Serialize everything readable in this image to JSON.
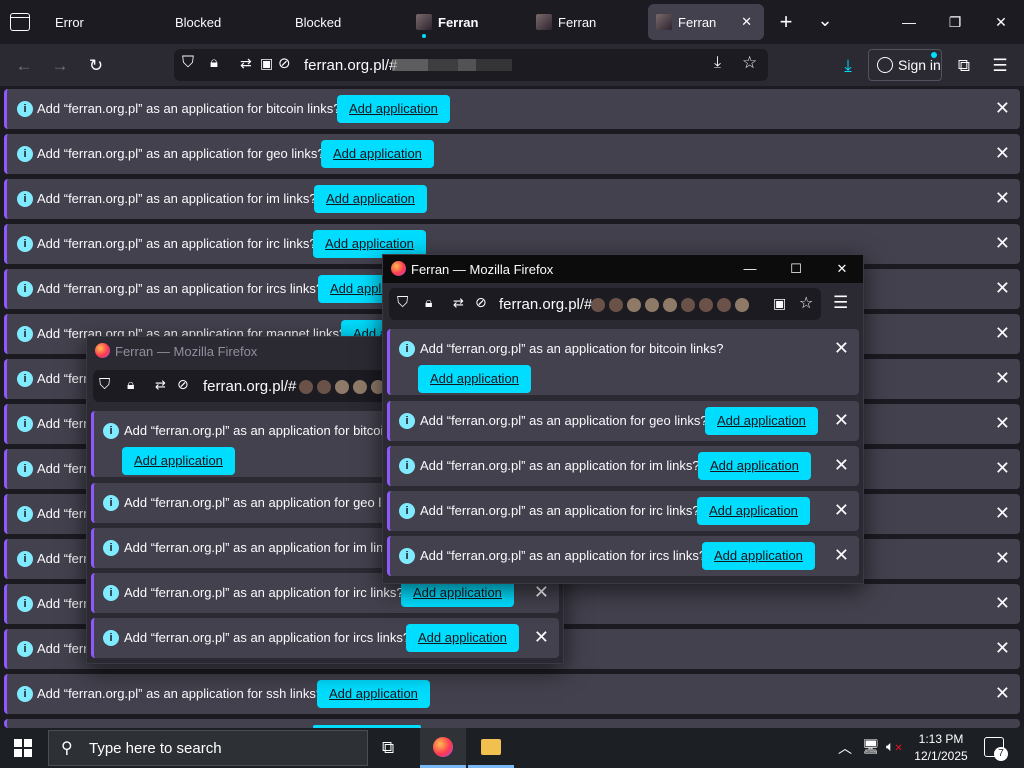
{
  "tabs": [
    {
      "label": "Error",
      "favicon": false
    },
    {
      "label": "Blocked",
      "favicon": false
    },
    {
      "label": "Blocked",
      "favicon": false
    },
    {
      "label": "Ferran",
      "favicon": true,
      "bold": true
    },
    {
      "label": "Ferran",
      "favicon": true
    },
    {
      "label": "Ferran",
      "favicon": true,
      "selected": true
    }
  ],
  "tab_close": "✕",
  "new_tab": "+",
  "tab_list": "⌄",
  "window_controls": {
    "minimize": "—",
    "maximize": "❐",
    "close": "✕"
  },
  "nav": {
    "url": "ferran.org.pl/#",
    "sign_in": "Sign in"
  },
  "notifications": [
    {
      "message": "Add “ferran.org.pl” as an application for bitcoin links?",
      "button": "Add application"
    },
    {
      "message": "Add “ferran.org.pl” as an application for geo links?",
      "button": "Add application"
    },
    {
      "message": "Add “ferran.org.pl” as an application for im links?",
      "button": "Add application"
    },
    {
      "message": "Add “ferran.org.pl” as an application for irc links?",
      "button": "Add application"
    },
    {
      "message": "Add “ferran.org.pl” as an application for ircs links?",
      "button": "Add application"
    },
    {
      "message": "Add “ferran.org.pl” as an application for magnet links?",
      "button": "Add application"
    },
    {
      "message": "Add “ferr",
      "button": ""
    },
    {
      "message": "Add “ferr",
      "button": ""
    },
    {
      "message": "Add “ferr",
      "button": ""
    },
    {
      "message": "Add “ferr",
      "button": ""
    },
    {
      "message": "Add “ferr",
      "button": ""
    },
    {
      "message": "Add “ferr",
      "button": ""
    },
    {
      "message": "Add “ferr",
      "button": ""
    },
    {
      "message": "Add “ferran.org.pl” as an application for ssh links?",
      "button": "Add application"
    }
  ],
  "popup_back": {
    "title": "Ferran — Mozilla Firefox",
    "url": "ferran.org.pl/#",
    "bars": [
      {
        "message": "Add “ferran.org.pl” as an application for bitcoin li",
        "button": "Add application"
      },
      {
        "message": "Add “ferran.org.pl” as an application for geo links",
        "button": ""
      },
      {
        "message": "Add “ferran.org.pl” as an application for im links?",
        "button": ""
      },
      {
        "message": "Add “ferran.org.pl” as an application for irc links?",
        "button": "Add application"
      },
      {
        "message": "Add “ferran.org.pl” as an application for ircs links?",
        "button": "Add application"
      }
    ]
  },
  "popup_front": {
    "title": "Ferran — Mozilla Firefox",
    "url": "ferran.org.pl/#",
    "bars": [
      {
        "message": "Add “ferran.org.pl” as an application for bitcoin links?",
        "button": "Add application"
      },
      {
        "message": "Add “ferran.org.pl” as an application for geo links?",
        "button": "Add application"
      },
      {
        "message": "Add “ferran.org.pl” as an application for im links?",
        "button": "Add application"
      },
      {
        "message": "Add “ferran.org.pl” as an application for irc links?",
        "button": "Add application"
      },
      {
        "message": "Add “ferran.org.pl” as an application for ircs links?",
        "button": "Add application"
      }
    ]
  },
  "taskbar": {
    "search_placeholder": "Type here to search",
    "time": "1:13 PM",
    "date": "12/1/2025",
    "notification_count": "7"
  },
  "colors": {
    "accent": "#00ddff",
    "bar_bg": "#42414d",
    "bar_border": "#9059ff"
  }
}
